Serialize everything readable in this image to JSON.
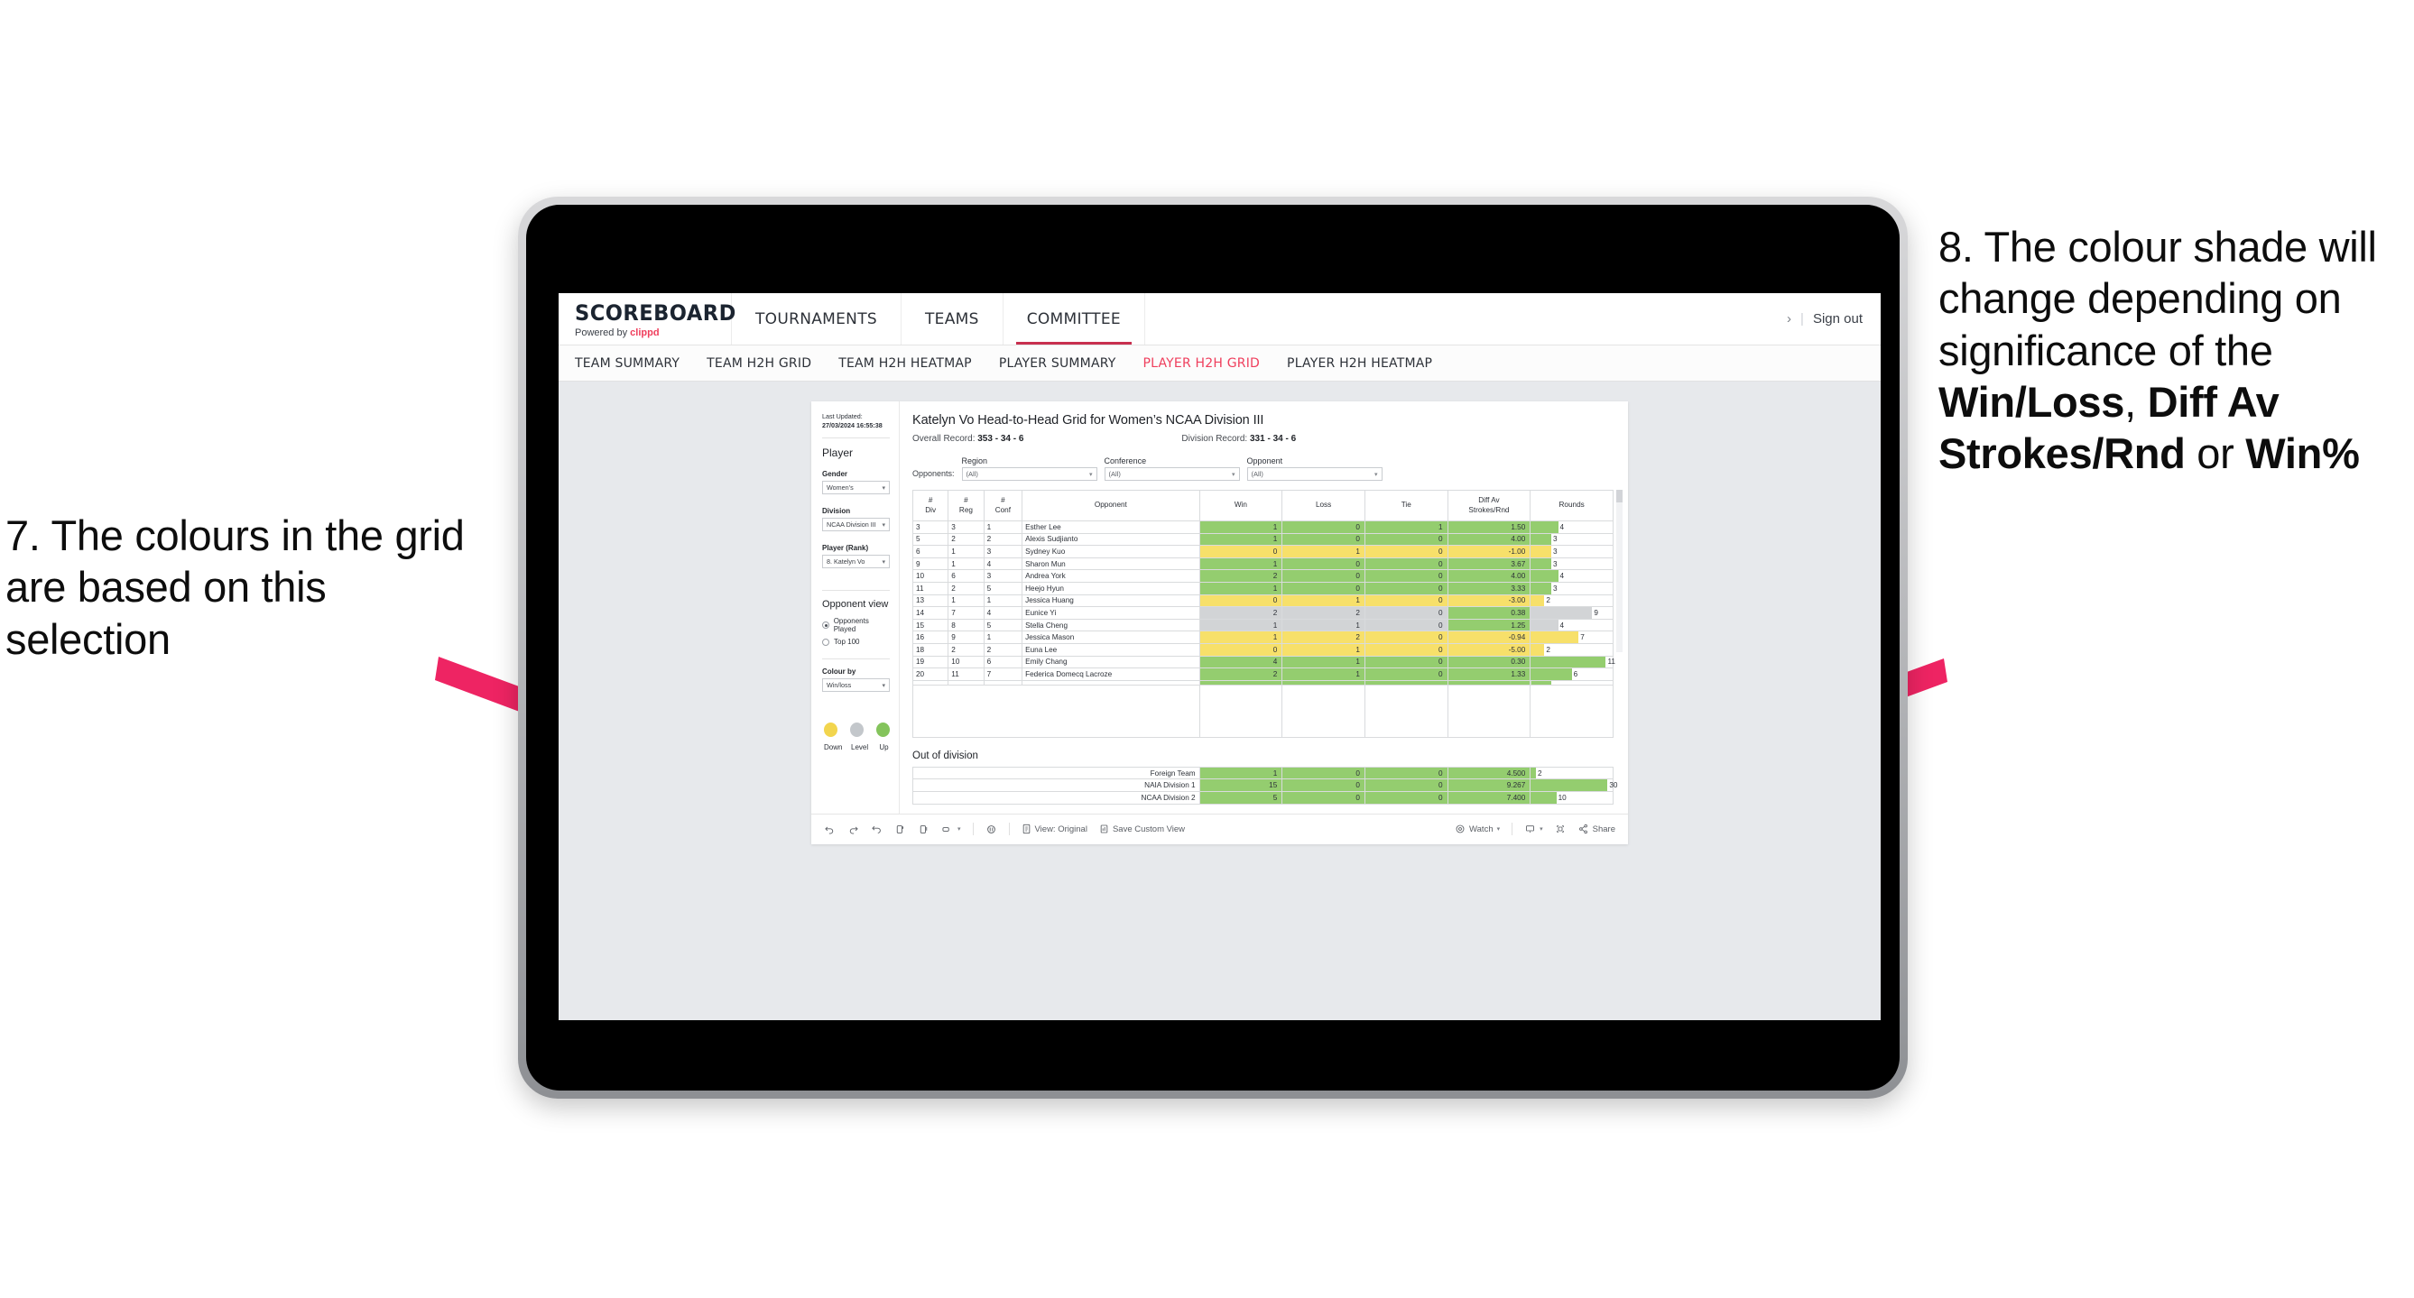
{
  "annotations": {
    "left": {
      "id": "7.",
      "text": "7. The colours in the grid are based on this selection"
    },
    "right": {
      "id": "8.",
      "line1": "8. The colour shade will change depending on significance of the ",
      "bold1": "Win/Loss",
      "mid1": ", ",
      "bold2": "Diff Av Strokes/Rnd",
      "mid2": " or ",
      "bold3": "Win%"
    },
    "arrow_color": "#ee2463"
  },
  "topnav": {
    "brand_main": "SCOREBOARD",
    "brand_sub_prefix": "Powered by ",
    "brand_sub_accent": "clippd",
    "links": [
      {
        "label": "TOURNAMENTS",
        "active": false
      },
      {
        "label": "TEAMS",
        "active": false
      },
      {
        "label": "COMMITTEE",
        "active": true
      }
    ],
    "chevron": "›",
    "divider": "|",
    "signout": "Sign out",
    "accent": "#c8304f"
  },
  "subnav": {
    "items": [
      {
        "label": "TEAM SUMMARY",
        "active": false
      },
      {
        "label": "TEAM H2H GRID",
        "active": false
      },
      {
        "label": "TEAM H2H HEATMAP",
        "active": false
      },
      {
        "label": "PLAYER SUMMARY",
        "active": false
      },
      {
        "label": "PLAYER H2H GRID",
        "active": true
      },
      {
        "label": "PLAYER H2H HEATMAP",
        "active": false
      }
    ],
    "active_color": "#ef3e5c"
  },
  "sidebar": {
    "last_updated_label": "Last Updated: ",
    "last_updated_value": "27/03/2024 16:55:38",
    "section_player": "Player",
    "gender": {
      "label": "Gender",
      "value": "Women’s"
    },
    "division": {
      "label": "Division",
      "value": "NCAA Division III"
    },
    "player_rank": {
      "label": "Player (Rank)",
      "value": "8. Katelyn Vo"
    },
    "opponent_view": {
      "title": "Opponent view",
      "options": [
        {
          "label": "Opponents Played",
          "selected": true
        },
        {
          "label": "Top 100",
          "selected": false
        }
      ]
    },
    "colour_by": {
      "label": "Colour by",
      "value": "Win/loss"
    },
    "legend": [
      {
        "label": "Down",
        "color": "#f2d54e"
      },
      {
        "label": "Level",
        "color": "#c3c7cb"
      },
      {
        "label": "Up",
        "color": "#84c45c"
      }
    ]
  },
  "main": {
    "title": "Katelyn Vo Head-to-Head Grid for Women’s NCAA Division III",
    "overall_record_label": "Overall Record: ",
    "overall_record_value": "353 - 34 - 6",
    "division_record_label": "Division Record: ",
    "division_record_value": "331 - 34 - 6",
    "opponents_label": "Opponents:",
    "filters": [
      {
        "label": "Region",
        "value": "(All)"
      },
      {
        "label": "Conference",
        "value": "(All)"
      },
      {
        "label": "Opponent",
        "value": "(All)"
      }
    ],
    "columns": [
      {
        "l1": "#",
        "l2": "Div"
      },
      {
        "l1": "#",
        "l2": "Reg"
      },
      {
        "l1": "#",
        "l2": "Conf"
      },
      {
        "l1": "Opponent",
        "l2": ""
      },
      {
        "l1": "Win",
        "l2": ""
      },
      {
        "l1": "Loss",
        "l2": ""
      },
      {
        "l1": "Tie",
        "l2": ""
      },
      {
        "l1": "Diff Av",
        "l2": "Strokes/Rnd"
      },
      {
        "l1": "Rounds",
        "l2": ""
      }
    ],
    "out_of_division_title": "Out of division"
  },
  "chart_data": {
    "type": "table",
    "title": "Katelyn Vo Head-to-Head Grid for Women’s NCAA Division III",
    "columns": [
      "# Div",
      "# Reg",
      "# Conf",
      "Opponent",
      "Win",
      "Loss",
      "Tie",
      "Diff Av Strokes/Rnd",
      "Rounds"
    ],
    "colors": {
      "up": "#94cd6f",
      "down": "#f7e06a",
      "level": "#d2d4d6"
    },
    "rounds_max": 12,
    "rows": [
      {
        "div": "3",
        "reg": "3",
        "conf": "1",
        "opponent": "Esther Lee",
        "win": "1",
        "loss": "0",
        "tie": "1",
        "diff": "1.50",
        "rounds": "4",
        "state": "up",
        "diff_state": "up"
      },
      {
        "div": "5",
        "reg": "2",
        "conf": "2",
        "opponent": "Alexis Sudjianto",
        "win": "1",
        "loss": "0",
        "tie": "0",
        "diff": "4.00",
        "rounds": "3",
        "state": "up",
        "diff_state": "up"
      },
      {
        "div": "6",
        "reg": "1",
        "conf": "3",
        "opponent": "Sydney Kuo",
        "win": "0",
        "loss": "1",
        "tie": "0",
        "diff": "-1.00",
        "rounds": "3",
        "state": "down",
        "diff_state": "down"
      },
      {
        "div": "9",
        "reg": "1",
        "conf": "4",
        "opponent": "Sharon Mun",
        "win": "1",
        "loss": "0",
        "tie": "0",
        "diff": "3.67",
        "rounds": "3",
        "state": "up",
        "diff_state": "up"
      },
      {
        "div": "10",
        "reg": "6",
        "conf": "3",
        "opponent": "Andrea York",
        "win": "2",
        "loss": "0",
        "tie": "0",
        "diff": "4.00",
        "rounds": "4",
        "state": "up",
        "diff_state": "up"
      },
      {
        "div": "11",
        "reg": "2",
        "conf": "5",
        "opponent": "Heejo Hyun",
        "win": "1",
        "loss": "0",
        "tie": "0",
        "diff": "3.33",
        "rounds": "3",
        "state": "up",
        "diff_state": "up"
      },
      {
        "div": "13",
        "reg": "1",
        "conf": "1",
        "opponent": "Jessica Huang",
        "win": "0",
        "loss": "1",
        "tie": "0",
        "diff": "-3.00",
        "rounds": "2",
        "state": "down",
        "diff_state": "down"
      },
      {
        "div": "14",
        "reg": "7",
        "conf": "4",
        "opponent": "Eunice Yi",
        "win": "2",
        "loss": "2",
        "tie": "0",
        "diff": "0.38",
        "rounds": "9",
        "state": "level",
        "diff_state": "up"
      },
      {
        "div": "15",
        "reg": "8",
        "conf": "5",
        "opponent": "Stella Cheng",
        "win": "1",
        "loss": "1",
        "tie": "0",
        "diff": "1.25",
        "rounds": "4",
        "state": "level",
        "diff_state": "up"
      },
      {
        "div": "16",
        "reg": "9",
        "conf": "1",
        "opponent": "Jessica Mason",
        "win": "1",
        "loss": "2",
        "tie": "0",
        "diff": "-0.94",
        "rounds": "7",
        "state": "down",
        "diff_state": "down"
      },
      {
        "div": "18",
        "reg": "2",
        "conf": "2",
        "opponent": "Euna Lee",
        "win": "0",
        "loss": "1",
        "tie": "0",
        "diff": "-5.00",
        "rounds": "2",
        "state": "down",
        "diff_state": "down"
      },
      {
        "div": "19",
        "reg": "10",
        "conf": "6",
        "opponent": "Emily Chang",
        "win": "4",
        "loss": "1",
        "tie": "0",
        "diff": "0.30",
        "rounds": "11",
        "state": "up",
        "diff_state": "up"
      },
      {
        "div": "20",
        "reg": "11",
        "conf": "7",
        "opponent": "Federica Domecq Lacroze",
        "win": "2",
        "loss": "1",
        "tie": "0",
        "diff": "1.33",
        "rounds": "6",
        "state": "up",
        "diff_state": "up"
      }
    ],
    "out_of_division": {
      "rounds_max": 32,
      "rows": [
        {
          "opponent": "Foreign Team",
          "win": "1",
          "loss": "0",
          "tie": "0",
          "diff": "4.500",
          "rounds": "2",
          "state": "up"
        },
        {
          "opponent": "NAIA Division 1",
          "win": "15",
          "loss": "0",
          "tie": "0",
          "diff": "9.267",
          "rounds": "30",
          "state": "up"
        },
        {
          "opponent": "NCAA Division 2",
          "win": "5",
          "loss": "0",
          "tie": "0",
          "diff": "7.400",
          "rounds": "10",
          "state": "up"
        }
      ]
    }
  },
  "toolbar": {
    "undo": "undo-icon",
    "redo": "redo-icon",
    "revert": "revert-icon",
    "refresh": "refresh-icon",
    "pause": "pause-icon",
    "view_original": "View: Original",
    "save_custom_view": "Save Custom View",
    "watch": "Watch",
    "share": "Share"
  }
}
